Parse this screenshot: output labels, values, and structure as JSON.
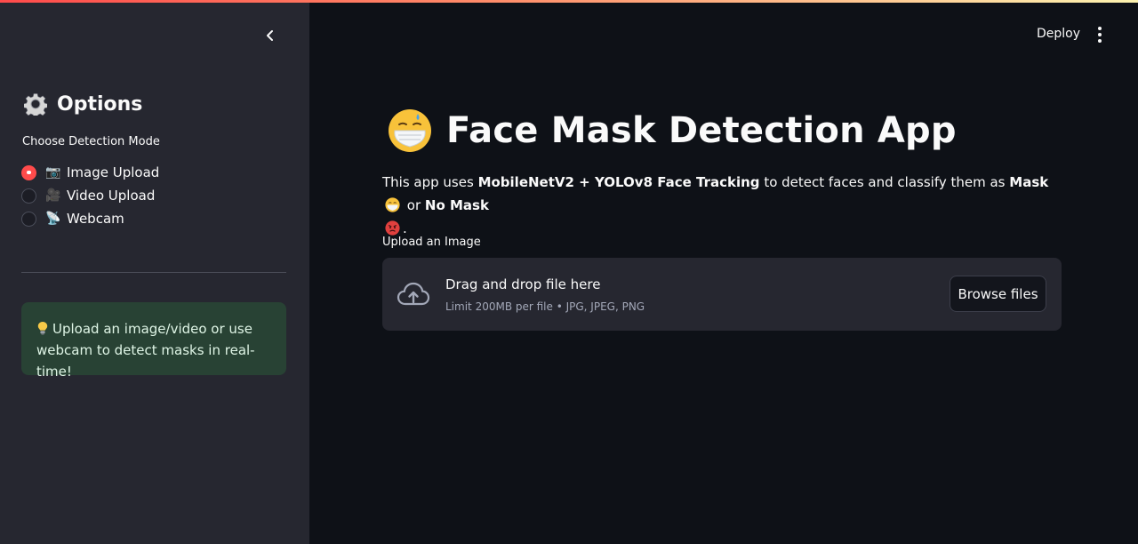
{
  "sidebar": {
    "collapse_icon": "chevron-left-icon",
    "title": "Options",
    "title_icon": "gear-icon",
    "mode_label": "Choose Detection Mode",
    "modes": [
      {
        "icon": "📷",
        "label": "Image Upload",
        "selected": true
      },
      {
        "icon": "🎥",
        "label": "Video Upload",
        "selected": false
      },
      {
        "icon": "📡",
        "label": "Webcam",
        "selected": false
      }
    ],
    "info": {
      "icon": "light-bulb-icon",
      "text": "Upload an image/video or use webcam to detect masks in real-time!"
    }
  },
  "header": {
    "deploy_label": "Deploy",
    "menu_icon": "more-vertical-icon"
  },
  "main": {
    "title": "Face Mask Detection App",
    "title_icon": "face-with-mask-icon",
    "description": {
      "p1": "This app uses ",
      "b1": "MobileNetV2 + YOLOv8 Face Tracking",
      "p2": " to detect faces and classify them as ",
      "b2": "Mask",
      "p3": " or ",
      "b3": "No Mask",
      "p4": "."
    },
    "uploader": {
      "label": "Upload an Image",
      "drop_title": "Drag and drop file here",
      "limit_text": "Limit 200MB per file • JPG, JPEG, PNG",
      "browse_label": "Browse files"
    }
  },
  "colors": {
    "accent": "#ff4b4b",
    "background": "#0e1117",
    "sidebar": "#262730",
    "info_box": "#284234"
  }
}
